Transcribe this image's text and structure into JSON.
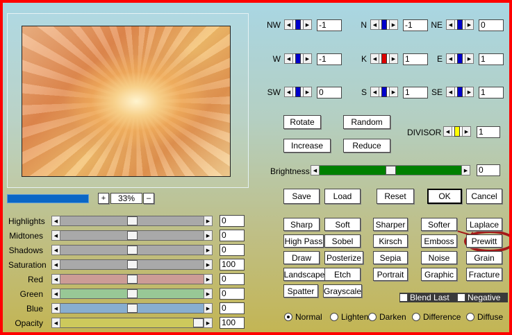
{
  "preview": {
    "zoom": "33%",
    "zoom_in": "+",
    "zoom_out": "–"
  },
  "matrix": {
    "cells": [
      {
        "label": "NW",
        "value": "-1",
        "color": "#0000cc"
      },
      {
        "label": "N",
        "value": "-1",
        "color": "#0000cc"
      },
      {
        "label": "NE",
        "value": "0",
        "color": "#0000cc"
      },
      {
        "label": "W",
        "value": "-1",
        "color": "#0000cc"
      },
      {
        "label": "K",
        "value": "1",
        "color": "#dd0000"
      },
      {
        "label": "E",
        "value": "1",
        "color": "#0000cc"
      },
      {
        "label": "SW",
        "value": "0",
        "color": "#0000cc"
      },
      {
        "label": "S",
        "value": "1",
        "color": "#0000cc"
      },
      {
        "label": "SE",
        "value": "1",
        "color": "#0000cc"
      }
    ]
  },
  "buttons": {
    "rotate": "Rotate",
    "random": "Random",
    "increase": "Increase",
    "reduce": "Reduce",
    "save": "Save",
    "load": "Load",
    "reset": "Reset",
    "ok": "OK",
    "cancel": "Cancel"
  },
  "divisor": {
    "label": "DIVISOR",
    "value": "1",
    "color": "#ffff00"
  },
  "brightness": {
    "label": "Brightness",
    "value": "0",
    "color": "#008000"
  },
  "adjustments": [
    {
      "label": "Highlights",
      "value": "0",
      "level": 0.5,
      "color": "#a9a9a9"
    },
    {
      "label": "Midtones",
      "value": "0",
      "level": 0.5,
      "color": "#a9a9a9"
    },
    {
      "label": "Shadows",
      "value": "0",
      "level": 0.5,
      "color": "#a9a9a9"
    },
    {
      "label": "Saturation",
      "value": "100",
      "level": 0.5,
      "color": "#a9a9a9"
    },
    {
      "label": "Red",
      "value": "0",
      "level": 0.5,
      "color": "#cc9c96"
    },
    {
      "label": "Green",
      "value": "0",
      "level": 0.5,
      "color": "#98c896"
    },
    {
      "label": "Blue",
      "value": "0",
      "level": 0.5,
      "color": "#88aed0"
    },
    {
      "label": "Opacity",
      "value": "100",
      "level": 1.0,
      "color": "#cdc95c"
    }
  ],
  "presets": [
    [
      "Sharp",
      "Soft",
      "Sharper",
      "Softer",
      "Laplace"
    ],
    [
      "High Pass",
      "Sobel",
      "Kirsch",
      "Emboss",
      "Prewitt"
    ],
    [
      "Draw",
      "Posterize",
      "Sepia",
      "Noise",
      "Grain"
    ],
    [
      "Landscape",
      "Etch",
      "Portrait",
      "Graphic",
      "Fracture"
    ],
    [
      "Spatter",
      "Grayscale"
    ]
  ],
  "options": {
    "blend_last": "Blend Last",
    "negative": "Negative"
  },
  "blend_modes": {
    "selected": "Normal",
    "items": [
      "Normal",
      "Lighten",
      "Darken",
      "Difference",
      "Diffuse"
    ]
  }
}
